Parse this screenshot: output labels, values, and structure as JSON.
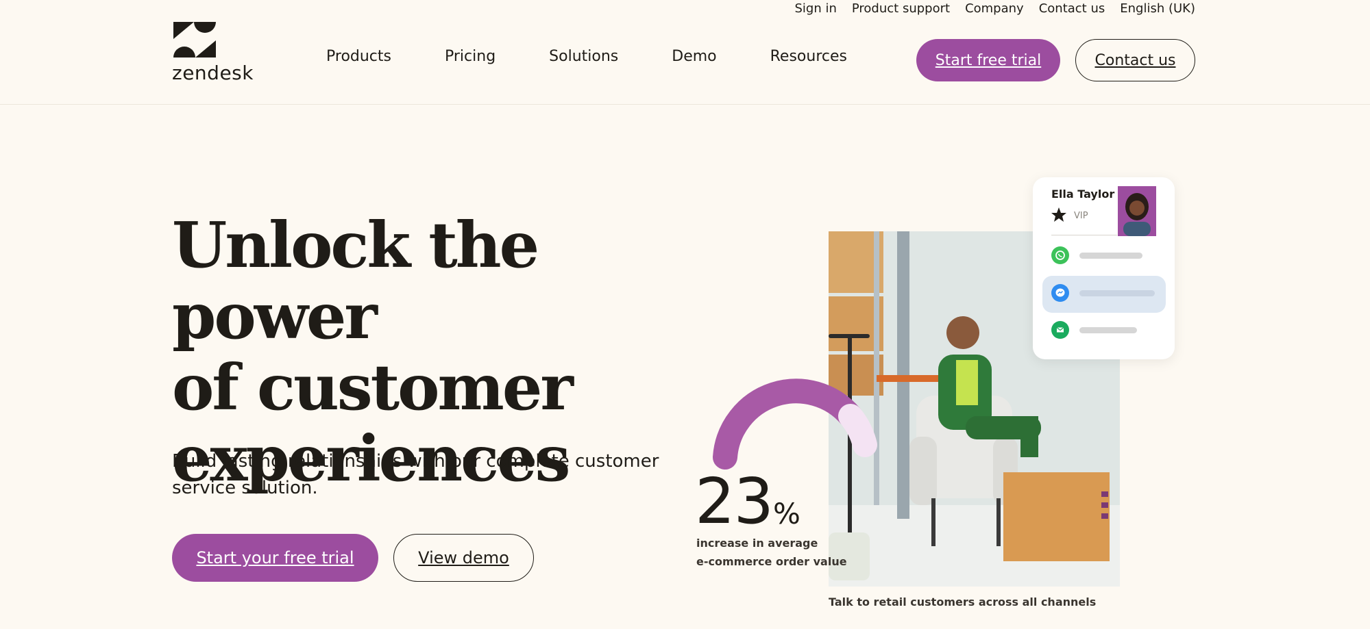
{
  "utility_nav": [
    "Sign in",
    "Product support",
    "Company",
    "Contact us",
    "English (UK)"
  ],
  "brand": {
    "name": "zendesk",
    "accent": "#9c4d9f"
  },
  "main_nav": [
    "Products",
    "Pricing",
    "Solutions",
    "Demo",
    "Resources"
  ],
  "header_buttons": {
    "trial": "Start free trial",
    "contact": "Contact us"
  },
  "hero": {
    "title_lines": [
      "Unlock the power",
      "of customer",
      "experiences"
    ],
    "subtitle": "Build lasting relationships with our complete customer service solution.",
    "primary_cta": "Start your free trial",
    "secondary_cta": "View demo"
  },
  "stat": {
    "value": "23",
    "unit": "%",
    "label_line1": "increase in average",
    "label_line2": "e-commerce order value"
  },
  "caption": "Talk to retail customers across all channels",
  "profile_card": {
    "name": "Ella Taylor",
    "tier": "VIP",
    "channels": [
      {
        "icon": "whatsapp-icon",
        "color": "#3cc25a"
      },
      {
        "icon": "messenger-icon",
        "color": "#2f8cf0"
      },
      {
        "icon": "email-icon",
        "color": "#1aab5e"
      }
    ]
  }
}
